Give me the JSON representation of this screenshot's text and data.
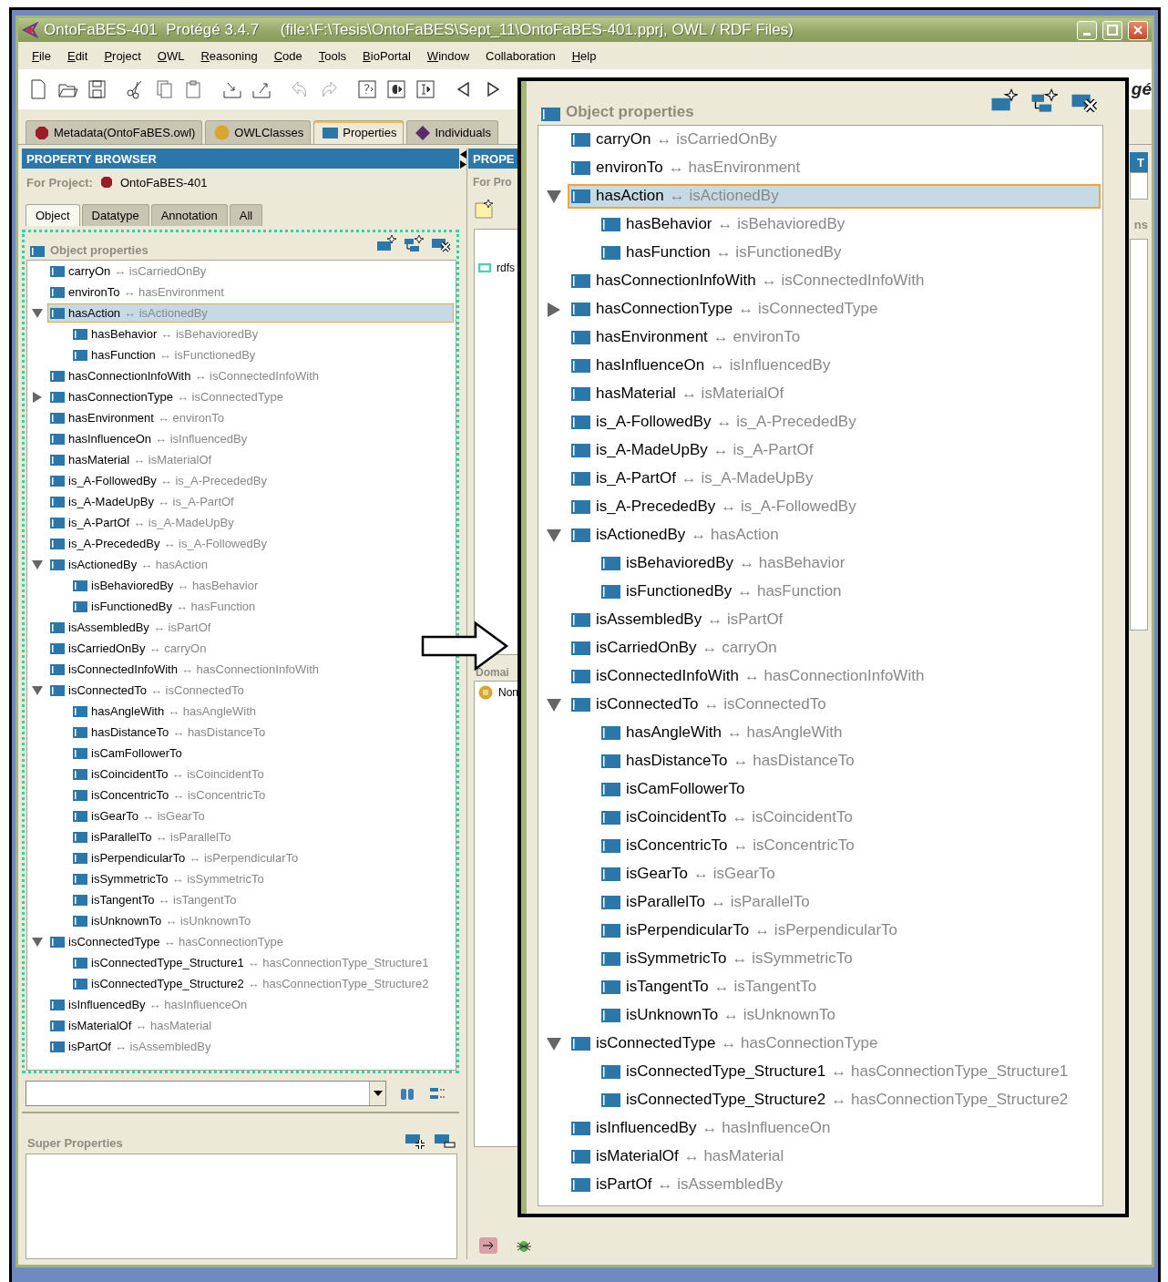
{
  "window": {
    "title": "OntoFaBES-401  Protégé 3.4.7     (file:\\F:\\Tesis\\OntoFaBES\\Sept_11\\OntoFaBES-401.pprj, OWL / RDF Files)"
  },
  "menu": [
    {
      "label": "File",
      "underline": true
    },
    {
      "label": "Edit",
      "underline": true
    },
    {
      "label": "Project",
      "underline": true
    },
    {
      "label": "OWL",
      "underline": true
    },
    {
      "label": "Reasoning",
      "underline": true
    },
    {
      "label": "Code",
      "underline": true
    },
    {
      "label": "Tools",
      "underline": true
    },
    {
      "label": "BioPortal",
      "underline": true
    },
    {
      "label": "Window",
      "underline": true
    },
    {
      "label": "Collaboration",
      "underline": false
    },
    {
      "label": "Help",
      "underline": true
    }
  ],
  "logo_text": "gé",
  "tabs": [
    {
      "label": "Metadata(OntoFaBES.owl)",
      "kind": "metadata",
      "selected": false
    },
    {
      "label": "OWLClasses",
      "kind": "classes",
      "selected": false
    },
    {
      "label": "Properties",
      "kind": "properties",
      "selected": true
    },
    {
      "label": "Individuals",
      "kind": "individuals",
      "selected": false
    }
  ],
  "browser": {
    "title": "PROPERTY BROWSER",
    "project_label": "For Project:",
    "project": "OntoFaBES-401",
    "subtabs": [
      {
        "label": "Object",
        "selected": true
      },
      {
        "label": "Datatype",
        "selected": false
      },
      {
        "label": "Annotation",
        "selected": false
      },
      {
        "label": "All",
        "selected": false
      }
    ],
    "tree_title": "Object properties",
    "tree": [
      {
        "name": "carryOn",
        "inverse": "↔ isCarriedOnBy",
        "selected": false
      },
      {
        "name": "environTo",
        "inverse": "↔ hasEnvironment",
        "selected": false
      },
      {
        "name": "hasAction",
        "inverse": "↔ isActionedBy",
        "expanded": true,
        "selected": true,
        "children": [
          {
            "name": "hasBehavior",
            "inverse": "↔ isBehavioredBy",
            "selected": false
          },
          {
            "name": "hasFunction",
            "inverse": "↔ isFunctionedBy",
            "selected": false
          }
        ]
      },
      {
        "name": "hasConnectionInfoWith",
        "inverse": "↔ isConnectedInfoWith",
        "selected": false
      },
      {
        "name": "hasConnectionType",
        "inverse": "↔ isConnectedType",
        "expanded": false,
        "selected": false
      },
      {
        "name": "hasEnvironment",
        "inverse": "↔ environTo",
        "selected": false
      },
      {
        "name": "hasInfluenceOn",
        "inverse": "↔ isInfluencedBy",
        "selected": false
      },
      {
        "name": "hasMaterial",
        "inverse": "↔ isMaterialOf",
        "selected": false
      },
      {
        "name": "is_A-FollowedBy",
        "inverse": "↔ is_A-PrecededBy",
        "selected": false
      },
      {
        "name": "is_A-MadeUpBy",
        "inverse": "↔ is_A-PartOf",
        "selected": false
      },
      {
        "name": "is_A-PartOf",
        "inverse": "↔ is_A-MadeUpBy",
        "selected": false
      },
      {
        "name": "is_A-PrecededBy",
        "inverse": "↔ is_A-FollowedBy",
        "selected": false
      },
      {
        "name": "isActionedBy",
        "inverse": "↔ hasAction",
        "expanded": true,
        "selected": false,
        "children": [
          {
            "name": "isBehavioredBy",
            "inverse": "↔ hasBehavior",
            "selected": false
          },
          {
            "name": "isFunctionedBy",
            "inverse": "↔ hasFunction",
            "selected": false
          }
        ]
      },
      {
        "name": "isAssembledBy",
        "inverse": "↔ isPartOf",
        "selected": false
      },
      {
        "name": "isCarriedOnBy",
        "inverse": "↔ carryOn",
        "selected": false
      },
      {
        "name": "isConnectedInfoWith",
        "inverse": "↔ hasConnectionInfoWith",
        "selected": false
      },
      {
        "name": "isConnectedTo",
        "inverse": "↔ isConnectedTo",
        "expanded": true,
        "selected": false,
        "children": [
          {
            "name": "hasAngleWith",
            "inverse": "↔ hasAngleWith",
            "selected": false
          },
          {
            "name": "hasDistanceTo",
            "inverse": "↔ hasDistanceTo",
            "selected": false
          },
          {
            "name": "isCamFollowerTo",
            "selected": false
          },
          {
            "name": "isCoincidentTo",
            "inverse": "↔ isCoincidentTo",
            "selected": false
          },
          {
            "name": "isConcentricTo",
            "inverse": "↔ isConcentricTo",
            "selected": false
          },
          {
            "name": "isGearTo",
            "inverse": "↔ isGearTo",
            "selected": false
          },
          {
            "name": "isParallelTo",
            "inverse": "↔ isParallelTo",
            "selected": false
          },
          {
            "name": "isPerpendicularTo",
            "inverse": "↔ isPerpendicularTo",
            "selected": false
          },
          {
            "name": "isSymmetricTo",
            "inverse": "↔ isSymmetricTo",
            "selected": false
          },
          {
            "name": "isTangentTo",
            "inverse": "↔ isTangentTo",
            "selected": false
          },
          {
            "name": "isUnknownTo",
            "inverse": "↔ isUnknownTo",
            "selected": false
          }
        ]
      },
      {
        "name": "isConnectedType",
        "inverse": "↔ hasConnectionType",
        "expanded": true,
        "selected": false,
        "children": [
          {
            "name": "isConnectedType_Structure1",
            "inverse": "↔ hasConnectionType_Structure1",
            "selected": false
          },
          {
            "name": "isConnectedType_Structure2",
            "inverse": "↔ hasConnectionType_Structure2",
            "selected": false
          }
        ]
      },
      {
        "name": "isInfluencedBy",
        "inverse": "↔ hasInfluenceOn",
        "selected": false
      },
      {
        "name": "isMaterialOf",
        "inverse": "↔ hasMaterial",
        "selected": false
      },
      {
        "name": "isPartOf",
        "inverse": "↔ isAssembledBy",
        "selected": false
      }
    ],
    "super_title": "Super Properties"
  },
  "middle": {
    "title": "PROPE",
    "project_label": "For Pro",
    "row": "rdfs",
    "domain_label": "Domai",
    "domain_item": "Non"
  },
  "right": {
    "button": "T",
    "label": "ns"
  },
  "inset": {
    "title": "Object properties",
    "tree": [
      {
        "name": "carryOn",
        "inverse": "↔ isCarriedOnBy",
        "selected": false
      },
      {
        "name": "environTo",
        "inverse": "↔ hasEnvironment",
        "selected": false
      },
      {
        "name": "hasAction",
        "inverse": "↔ isActionedBy",
        "expanded": true,
        "selected": true,
        "children": [
          {
            "name": "hasBehavior",
            "inverse": "↔ isBehavioredBy",
            "selected": false
          },
          {
            "name": "hasFunction",
            "inverse": "↔ isFunctionedBy",
            "selected": false
          }
        ]
      },
      {
        "name": "hasConnectionInfoWith",
        "inverse": "↔ isConnectedInfoWith",
        "selected": false
      },
      {
        "name": "hasConnectionType",
        "inverse": "↔ isConnectedType",
        "expanded": false,
        "selected": false
      },
      {
        "name": "hasEnvironment",
        "inverse": "↔ environTo",
        "selected": false
      },
      {
        "name": "hasInfluenceOn",
        "inverse": "↔ isInfluencedBy",
        "selected": false
      },
      {
        "name": "hasMaterial",
        "inverse": "↔ isMaterialOf",
        "selected": false
      },
      {
        "name": "is_A-FollowedBy",
        "inverse": "↔ is_A-PrecededBy",
        "selected": false
      },
      {
        "name": "is_A-MadeUpBy",
        "inverse": "↔ is_A-PartOf",
        "selected": false
      },
      {
        "name": "is_A-PartOf",
        "inverse": "↔ is_A-MadeUpBy",
        "selected": false
      },
      {
        "name": "is_A-PrecededBy",
        "inverse": "↔ is_A-FollowedBy",
        "selected": false
      },
      {
        "name": "isActionedBy",
        "inverse": "↔ hasAction",
        "expanded": true,
        "selected": false,
        "children": [
          {
            "name": "isBehavioredBy",
            "inverse": "↔ hasBehavior",
            "selected": false
          },
          {
            "name": "isFunctionedBy",
            "inverse": "↔ hasFunction",
            "selected": false
          }
        ]
      },
      {
        "name": "isAssembledBy",
        "inverse": "↔ isPartOf",
        "selected": false
      },
      {
        "name": "isCarriedOnBy",
        "inverse": "↔ carryOn",
        "selected": false
      },
      {
        "name": "isConnectedInfoWith",
        "inverse": "↔ hasConnectionInfoWith",
        "selected": false
      },
      {
        "name": "isConnectedTo",
        "inverse": "↔ isConnectedTo",
        "expanded": true,
        "selected": false,
        "children": [
          {
            "name": "hasAngleWith",
            "inverse": "↔ hasAngleWith",
            "selected": false
          },
          {
            "name": "hasDistanceTo",
            "inverse": "↔ hasDistanceTo",
            "selected": false
          },
          {
            "name": "isCamFollowerTo",
            "selected": false
          },
          {
            "name": "isCoincidentTo",
            "inverse": "↔ isCoincidentTo",
            "selected": false
          },
          {
            "name": "isConcentricTo",
            "inverse": "↔ isConcentricTo",
            "selected": false
          },
          {
            "name": "isGearTo",
            "inverse": "↔ isGearTo",
            "selected": false
          },
          {
            "name": "isParallelTo",
            "inverse": "↔ isParallelTo",
            "selected": false
          },
          {
            "name": "isPerpendicularTo",
            "inverse": "↔ isPerpendicularTo",
            "selected": false
          },
          {
            "name": "isSymmetricTo",
            "inverse": "↔ isSymmetricTo",
            "selected": false
          },
          {
            "name": "isTangentTo",
            "inverse": "↔ isTangentTo",
            "selected": false
          },
          {
            "name": "isUnknownTo",
            "inverse": "↔ isUnknownTo",
            "selected": false
          }
        ]
      },
      {
        "name": "isConnectedType",
        "inverse": "↔ hasConnectionType",
        "expanded": true,
        "selected": false,
        "children": [
          {
            "name": "isConnectedType_Structure1",
            "inverse": "↔ hasConnectionType_Structure1",
            "selected": false
          },
          {
            "name": "isConnectedType_Structure2",
            "inverse": "↔ hasConnectionType_Structure2",
            "selected": false
          }
        ]
      },
      {
        "name": "isInfluencedBy",
        "inverse": "↔ hasInfluenceOn",
        "selected": false
      },
      {
        "name": "isMaterialOf",
        "inverse": "↔ hasMaterial",
        "selected": false
      },
      {
        "name": "isPartOf",
        "inverse": "↔ isAssembledBy",
        "selected": false
      }
    ]
  }
}
